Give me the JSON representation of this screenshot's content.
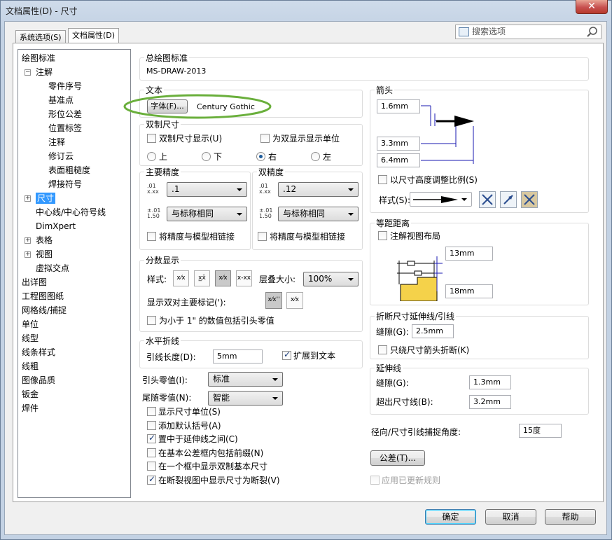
{
  "window": {
    "title": "文档属性(D) - 尺寸",
    "close": "✕"
  },
  "tabs": [
    "系统选项(S)",
    "文档属性(D)"
  ],
  "search": {
    "placeholder": "搜索选项"
  },
  "tree": [
    {
      "label": "绘图标准",
      "level": 0
    },
    {
      "label": "注解",
      "level": 1,
      "exp": "−"
    },
    {
      "label": "零件序号",
      "level": 2
    },
    {
      "label": "基准点",
      "level": 2
    },
    {
      "label": "形位公差",
      "level": 2
    },
    {
      "label": "位置标签",
      "level": 2
    },
    {
      "label": "注释",
      "level": 2
    },
    {
      "label": "修订云",
      "level": 2
    },
    {
      "label": "表面粗糙度",
      "level": 2
    },
    {
      "label": "焊接符号",
      "level": 2
    },
    {
      "label": "尺寸",
      "level": 1,
      "exp": "+",
      "selected": true
    },
    {
      "label": "中心线/中心符号线",
      "level": 1
    },
    {
      "label": "DimXpert",
      "level": 1
    },
    {
      "label": "表格",
      "level": 1,
      "exp": "+"
    },
    {
      "label": "视图",
      "level": 1,
      "exp": "+"
    },
    {
      "label": "虚拟交点",
      "level": 1
    },
    {
      "label": "出详图",
      "level": 0
    },
    {
      "label": "工程图图纸",
      "level": 0
    },
    {
      "label": "网格线/捕捉",
      "level": 0
    },
    {
      "label": "单位",
      "level": 0
    },
    {
      "label": "线型",
      "level": 0
    },
    {
      "label": "线条样式",
      "level": 0
    },
    {
      "label": "线粗",
      "level": 0
    },
    {
      "label": "图像品质",
      "level": 0
    },
    {
      "label": "钣金",
      "level": 0
    },
    {
      "label": "焊件",
      "level": 0
    }
  ],
  "overall": {
    "label": "总绘图标准",
    "value": "MS-DRAW-2013"
  },
  "text": {
    "label": "文本",
    "font_button": "字体(F)...",
    "font_name": "Century Gothic"
  },
  "dual": {
    "label": "双制尺寸",
    "show": "双制尺寸显示(U)",
    "units": "为双显示显示单位",
    "pos": [
      "上",
      "下",
      "右",
      "左"
    ]
  },
  "primary": {
    "label": "主要精度",
    "v1": ".1",
    "v2": "与标称相同",
    "link": "将精度与模型相链接"
  },
  "dualp": {
    "label": "双精度",
    "v1": ".12",
    "v2": "与标称相同",
    "link": "将精度与模型相链接"
  },
  "prec_icons": {
    "a": "x.xx",
    "b": ".01",
    "c": "1.50",
    "d": "±.01"
  },
  "fraction": {
    "label": "分数显示",
    "style": "样式:",
    "icons": [
      "x⁄x",
      "x̲x̄",
      "x⁄x",
      "x-xx"
    ],
    "stack": "层叠大小:",
    "stack_value": "100%",
    "dualshow": "显示双对主要标记('):",
    "dual_icons": [
      "x⁄x''",
      "x⁄x"
    ],
    "zero": "为小于 1\" 的数值包括引头零值"
  },
  "hbreak": {
    "label": "水平折线",
    "len": "引线长度(D):",
    "value": "5mm",
    "extend": "扩展到文本"
  },
  "leadzero": {
    "label": "引头零值(I):",
    "value": "标准"
  },
  "trailzero": {
    "label": "尾随零值(N):",
    "value": "智能"
  },
  "checks": [
    {
      "label": "显示尺寸单位(S)",
      "on": false
    },
    {
      "label": "添加默认括号(A)",
      "on": false
    },
    {
      "label": "置中于延伸线之间(C)",
      "on": true
    },
    {
      "label": "在基本公差框内包括前缀(N)",
      "on": false
    },
    {
      "label": "在一个框中显示双制基本尺寸",
      "on": false
    },
    {
      "label": "在断裂视图中显示尺寸为断裂(V)",
      "on": true
    }
  ],
  "arrows": {
    "label": "箭头",
    "v1": "1.6mm",
    "v2": "3.3mm",
    "v3": "6.4mm",
    "scale": "以尺寸高度调整比例(S)",
    "style": "样式(S):"
  },
  "offset": {
    "label": "等距距离",
    "layout": "注解视图布局",
    "v1": "13mm",
    "v2": "18mm"
  },
  "bent": {
    "label": "折断尺寸延伸线/引线",
    "gap": "缝隙(G):",
    "value": "2.5mm",
    "only": "只绕尺寸箭头折断(K)"
  },
  "ext": {
    "label": "延伸线",
    "gap": "缝隙(G):",
    "gap_value": "1.3mm",
    "beyond": "超出尺寸线(B):",
    "beyond_value": "3.2mm"
  },
  "radial": {
    "label": "径向/尺寸引线捕捉角度:",
    "value": "15度"
  },
  "tol_button": "公差(T)...",
  "apply_updated": "应用已更新规则",
  "buttons": {
    "ok": "确定",
    "cancel": "取消",
    "help": "帮助"
  },
  "colors": {
    "accent": "#3399ff",
    "highlight": "#6aaf3c"
  }
}
